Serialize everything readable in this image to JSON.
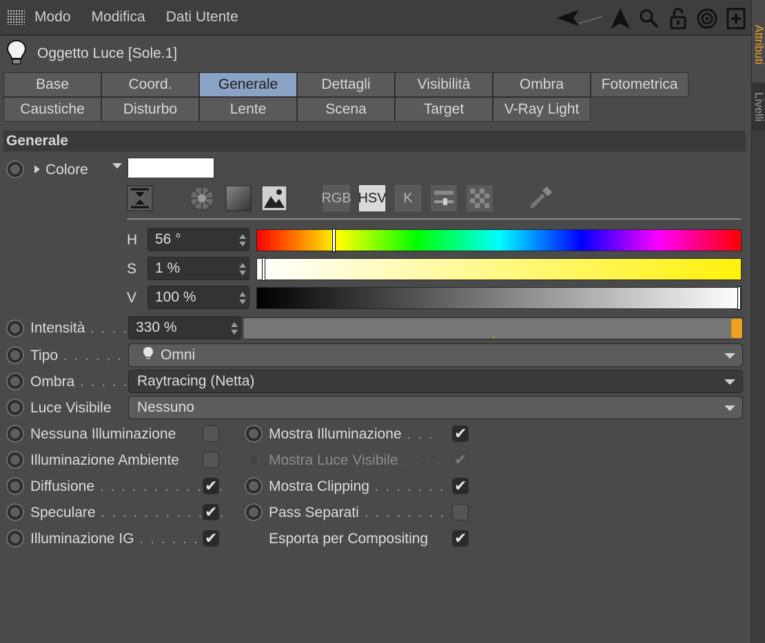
{
  "menu": [
    "Modo",
    "Modifica",
    "Dati Utente"
  ],
  "object_title": "Oggetto Luce [Sole.1]",
  "side_tabs": [
    "Attributi",
    "Livelli"
  ],
  "tabs_row1": [
    "Base",
    "Coord.",
    "Generale",
    "Dettagli",
    "Visibilità",
    "Ombra",
    "Fotometrica"
  ],
  "tabs_row2": [
    "Caustiche",
    "Disturbo",
    "Lente",
    "Scena",
    "Target",
    "V-Ray Light"
  ],
  "active_tab": "Generale",
  "section_title": "Generale",
  "color": {
    "label": "Colore",
    "swatch": "#ffffff",
    "modes": [
      "RGB",
      "HSV",
      "K"
    ],
    "active_mode": "HSV",
    "h_label": "H",
    "h_value": "56 °",
    "s_label": "S",
    "s_value": "1 %",
    "v_label": "V",
    "v_value": "100 %",
    "h_fraction": 0.156,
    "s_fraction": 0.01,
    "v_fraction": 1.0
  },
  "intensity": {
    "label": "Intensità",
    "value": "330 %",
    "fraction": 1.0,
    "accent": "#f0a020"
  },
  "tipo": {
    "label": "Tipo",
    "value": "Omni"
  },
  "ombra": {
    "label": "Ombra",
    "value": "Raytracing (Netta)"
  },
  "luce_visibile": {
    "label": "Luce Visibile",
    "value": "Nessuno"
  },
  "left_options": [
    {
      "label": "Nessuna Illuminazione",
      "checked": false
    },
    {
      "label": "Illuminazione Ambiente",
      "checked": false
    },
    {
      "label": "Diffusione",
      "checked": true
    },
    {
      "label": "Speculare",
      "checked": true
    },
    {
      "label": "Illuminazione IG",
      "checked": true
    }
  ],
  "right_options": [
    {
      "label": "Mostra Illuminazione",
      "checked": true
    },
    {
      "label": "Mostra Luce Visibile",
      "checked": true,
      "disabled": true
    },
    {
      "label": "Mostra Clipping",
      "checked": true
    },
    {
      "label": "Pass Separati",
      "checked": false
    },
    {
      "label": "Esporta per Compositing",
      "checked": true
    }
  ]
}
